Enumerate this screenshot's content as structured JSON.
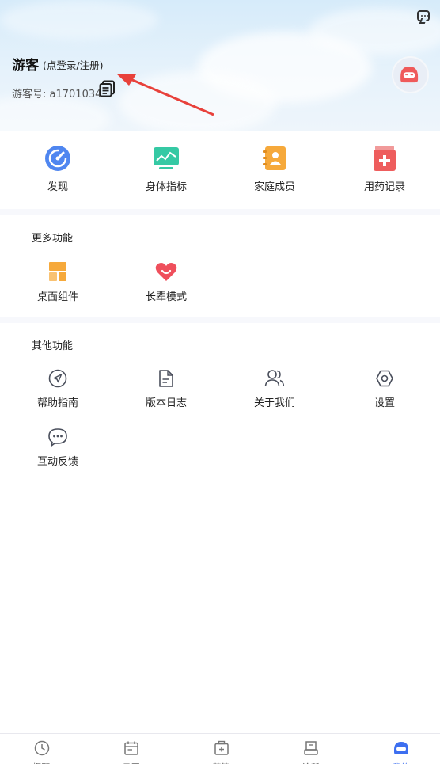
{
  "header": {
    "name": "游客",
    "login_hint": "(点登录/注册)",
    "guest_id": "游客号: a1701034",
    "message_icon": "chat-bubble-icon",
    "copy_icon": "copy-icon",
    "avatar_icon": "robot-avatar-icon"
  },
  "main_grid": [
    {
      "label": "发现",
      "icon": "compass-icon"
    },
    {
      "label": "身体指标",
      "icon": "monitor-chart-icon"
    },
    {
      "label": "家庭成员",
      "icon": "contacts-book-icon"
    },
    {
      "label": "用药记录",
      "icon": "medicine-record-icon"
    }
  ],
  "more": {
    "title": "更多功能",
    "items": [
      {
        "label": "桌面组件",
        "icon": "widget-icon"
      },
      {
        "label": "长辈模式",
        "icon": "heart-smile-icon"
      }
    ]
  },
  "other": {
    "title": "其他功能",
    "items": [
      {
        "label": "帮助指南",
        "icon": "send-circle-icon"
      },
      {
        "label": "版本日志",
        "icon": "document-icon"
      },
      {
        "label": "关于我们",
        "icon": "users-icon"
      },
      {
        "label": "设置",
        "icon": "settings-hexagon-icon"
      },
      {
        "label": "互动反馈",
        "icon": "feedback-bubble-icon"
      }
    ]
  },
  "bottom_nav": [
    {
      "label": "提醒",
      "icon": "clock-icon"
    },
    {
      "label": "日历",
      "icon": "calendar-icon"
    },
    {
      "label": "药箱",
      "icon": "medicine-box-icon"
    },
    {
      "label": "诊所",
      "icon": "clinic-icon"
    },
    {
      "label": "我的",
      "icon": "robot-face-icon",
      "active": true
    }
  ],
  "colors": {
    "accent": "#3d6ff0",
    "arrow": "#e8413b"
  }
}
